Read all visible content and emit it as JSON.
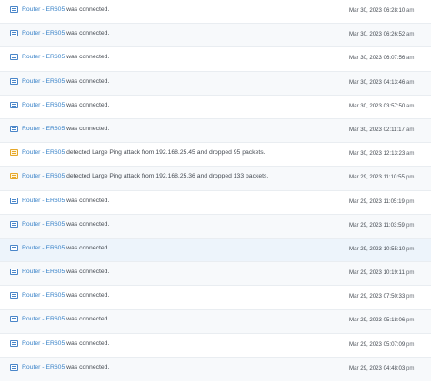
{
  "logs": [
    {
      "device": "Router - ER605",
      "message": "was connected.",
      "time": "Mar 30, 2023 06:28:10",
      "ampm": "am",
      "icon": "log-icon"
    },
    {
      "device": "Router - ER605",
      "message": "was connected.",
      "time": "Mar 30, 2023 06:26:52",
      "ampm": "am",
      "icon": "log-icon"
    },
    {
      "device": "Router - ER605",
      "message": "was connected.",
      "time": "Mar 30, 2023 06:07:56",
      "ampm": "am",
      "icon": "log-icon"
    },
    {
      "device": "Router - ER605",
      "message": "was connected.",
      "time": "Mar 30, 2023 04:13:46",
      "ampm": "am",
      "icon": "log-icon"
    },
    {
      "device": "Router - ER605",
      "message": "was connected.",
      "time": "Mar 30, 2023 03:57:50",
      "ampm": "am",
      "icon": "log-icon"
    },
    {
      "device": "Router - ER605",
      "message": "was connected.",
      "time": "Mar 30, 2023 02:11:17",
      "ampm": "am",
      "icon": "log-icon"
    },
    {
      "device": "Router - ER605",
      "message": "detected Large Ping attack from 192.168.25.45 and dropped 95 packets.",
      "time": "Mar 30, 2023 12:13:23",
      "ampm": "am",
      "icon": "warning-log-icon"
    },
    {
      "device": "Router - ER605",
      "message": "detected Large Ping attack from 192.168.25.36 and dropped 133 packets.",
      "time": "Mar 29, 2023 11:10:55",
      "ampm": "pm",
      "icon": "warning-log-icon"
    },
    {
      "device": "Router - ER605",
      "message": "was connected.",
      "time": "Mar 29, 2023 11:05:19",
      "ampm": "pm",
      "icon": "log-icon"
    },
    {
      "device": "Router - ER605",
      "message": "was connected.",
      "time": "Mar 29, 2023 11:03:59",
      "ampm": "pm",
      "icon": "log-icon"
    },
    {
      "device": "Router - ER605",
      "message": "was connected.",
      "time": "Mar 29, 2023 10:55:10",
      "ampm": "pm",
      "icon": "log-icon"
    },
    {
      "device": "Router - ER605",
      "message": "was connected.",
      "time": "Mar 29, 2023 10:19:11",
      "ampm": "pm",
      "icon": "log-icon"
    },
    {
      "device": "Router - ER605",
      "message": "was connected.",
      "time": "Mar 29, 2023 07:50:33",
      "ampm": "pm",
      "icon": "log-icon"
    },
    {
      "device": "Router - ER605",
      "message": "was connected.",
      "time": "Mar 29, 2023 05:18:06",
      "ampm": "pm",
      "icon": "log-icon"
    },
    {
      "device": "Router - ER605",
      "message": "was connected.",
      "time": "Mar 29, 2023 05:07:09",
      "ampm": "pm",
      "icon": "log-icon"
    },
    {
      "device": "Router - ER605",
      "message": "was connected.",
      "time": "Mar 29, 2023 04:48:03",
      "ampm": "pm",
      "icon": "log-icon"
    }
  ],
  "colors": {
    "link": "#3a83c8",
    "text": "#444a52",
    "warning": "#e6a82a",
    "row_highlight": "#edf4fb"
  }
}
